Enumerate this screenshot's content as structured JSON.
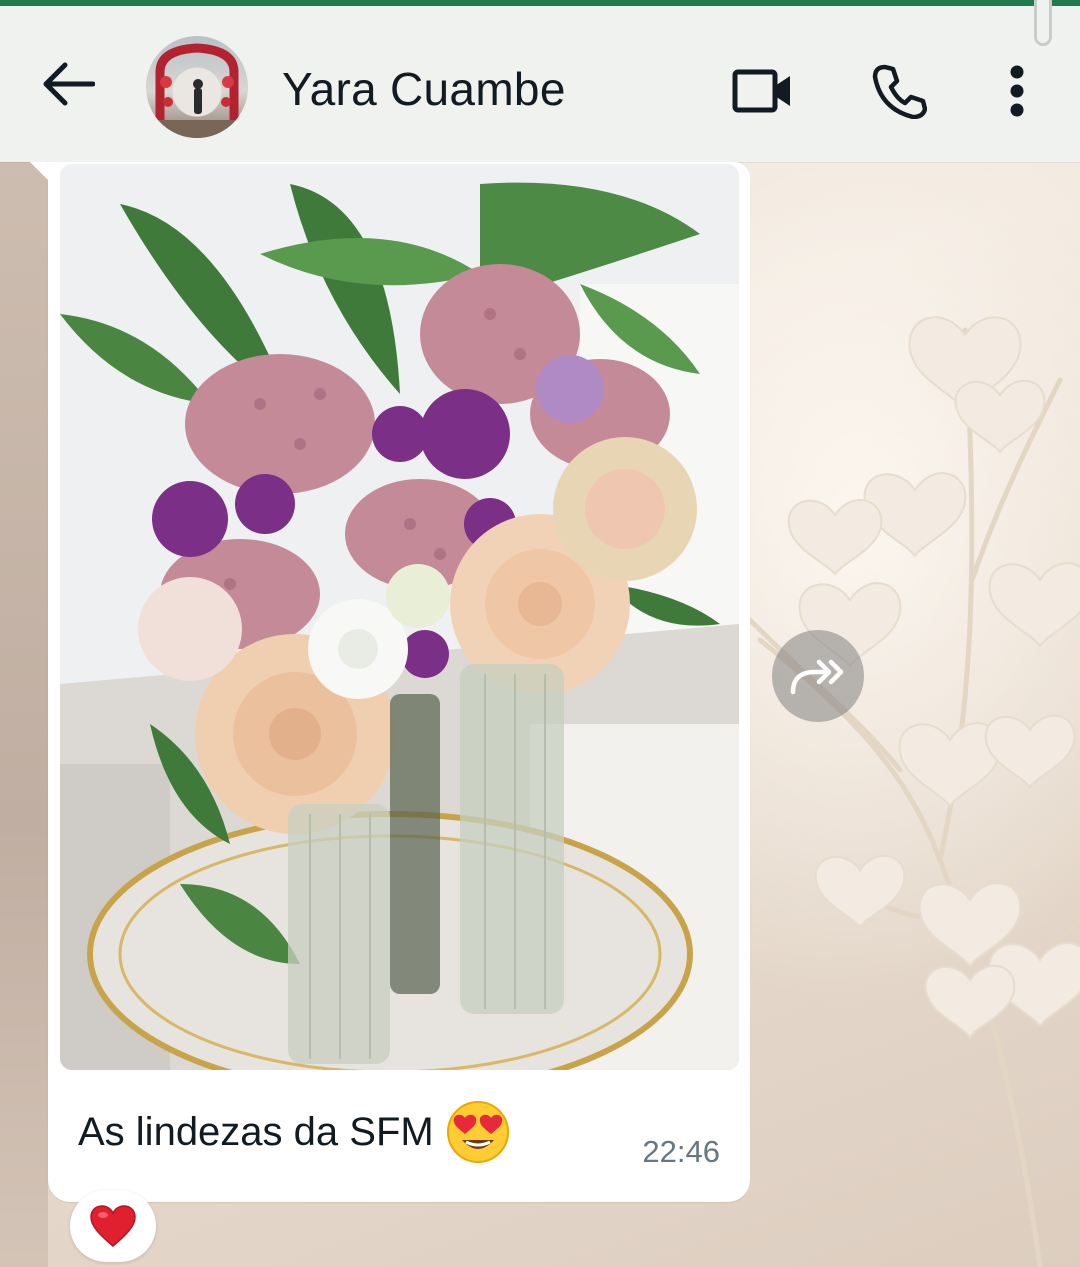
{
  "header": {
    "contact_name": "Yara Cuambe",
    "back_icon": "arrow-left-icon",
    "video_icon": "video-call-icon",
    "call_icon": "phone-icon",
    "menu_icon": "more-vertical-icon",
    "background_color": "#f0f2ef",
    "accent_color": "#1f7a4d"
  },
  "message": {
    "type": "image",
    "caption": "As lindezas da SFM",
    "caption_emoji": "heart-eyes-emoji",
    "time": "22:46",
    "bubble_color": "#ffffff"
  },
  "actions": {
    "forward_icon": "forward-icon"
  },
  "reaction": {
    "emoji": "red-heart-emoji"
  }
}
